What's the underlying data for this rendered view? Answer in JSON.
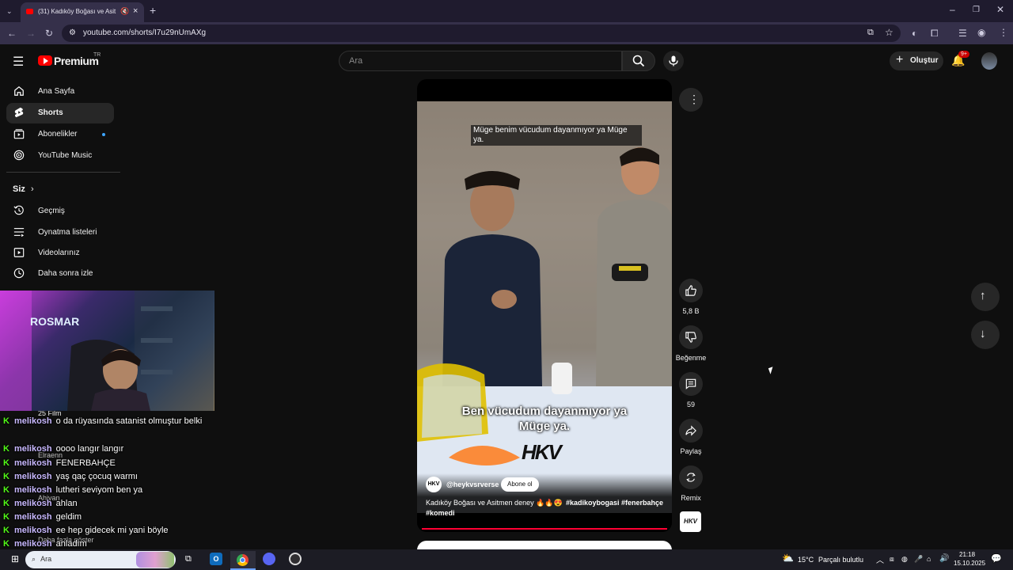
{
  "browser": {
    "tab_title": "(31) Kadıköy Boğası ve Asit",
    "url": "youtube.com/shorts/I7u29nUmAXg"
  },
  "header": {
    "logo_text": "Premium",
    "country": "TR",
    "search_placeholder": "Ara",
    "create_label": "Oluştur",
    "notif_badge": "9+"
  },
  "sidebar": {
    "items": [
      {
        "label": "Ana Sayfa"
      },
      {
        "label": "Shorts"
      },
      {
        "label": "Abonelikler"
      },
      {
        "label": "YouTube Music"
      }
    ],
    "you_title": "Siz",
    "you_items": [
      {
        "label": "Geçmiş"
      },
      {
        "label": "Oynatma listeleri"
      },
      {
        "label": "Videolarınız"
      },
      {
        "label": "Daha sonra izle"
      }
    ],
    "partial_items": [
      "25 Film",
      "Elraenn",
      "Ahiyan",
      "Daha fazla göster"
    ]
  },
  "video": {
    "caption_top": "Müge benim vücudum dayanmıyor ya Müge ya.",
    "caption_bottom": "Ben vücudum dayanmıyor ya Müge ya.",
    "watermark": "HKV",
    "channel": "@heykvsrverse",
    "subscribe_label": "Abone ol",
    "title": "Kadıköy Boğası ve Asitmen deney 🔥🔥😍",
    "hashtags_line1": "#kadikoybogasi #fenerbahçe",
    "hashtags_line2": "#komedi"
  },
  "actions": {
    "likes": "5,8 B",
    "dislike_label": "Beğenme",
    "comments": "59",
    "share_label": "Paylaş",
    "remix_label": "Remix"
  },
  "chat": {
    "messages": [
      {
        "user": "melikosh",
        "text": "o da rüyasında satanist olmuştur belki"
      },
      {
        "user": "melikosh",
        "text": "oooo langır langır"
      },
      {
        "user": "melikosh",
        "text": "FENERBAHÇE"
      },
      {
        "user": "melikosh",
        "text": "yaş qaç çocuq warmı"
      },
      {
        "user": "melikosh",
        "text": "lutheri seviyom ben ya"
      },
      {
        "user": "melikosh",
        "text": "ahlan"
      },
      {
        "user": "melikosh",
        "text": "geldim"
      },
      {
        "user": "melikosh",
        "text": "ee hep gidecek mi yani böyle"
      },
      {
        "user": "melikosh",
        "text": "anladım"
      }
    ]
  },
  "taskbar": {
    "search_placeholder": "Ara",
    "temperature": "15°C",
    "weather": "Parçalı bulutlu",
    "time": "21:18",
    "date": "15.10.2025"
  }
}
